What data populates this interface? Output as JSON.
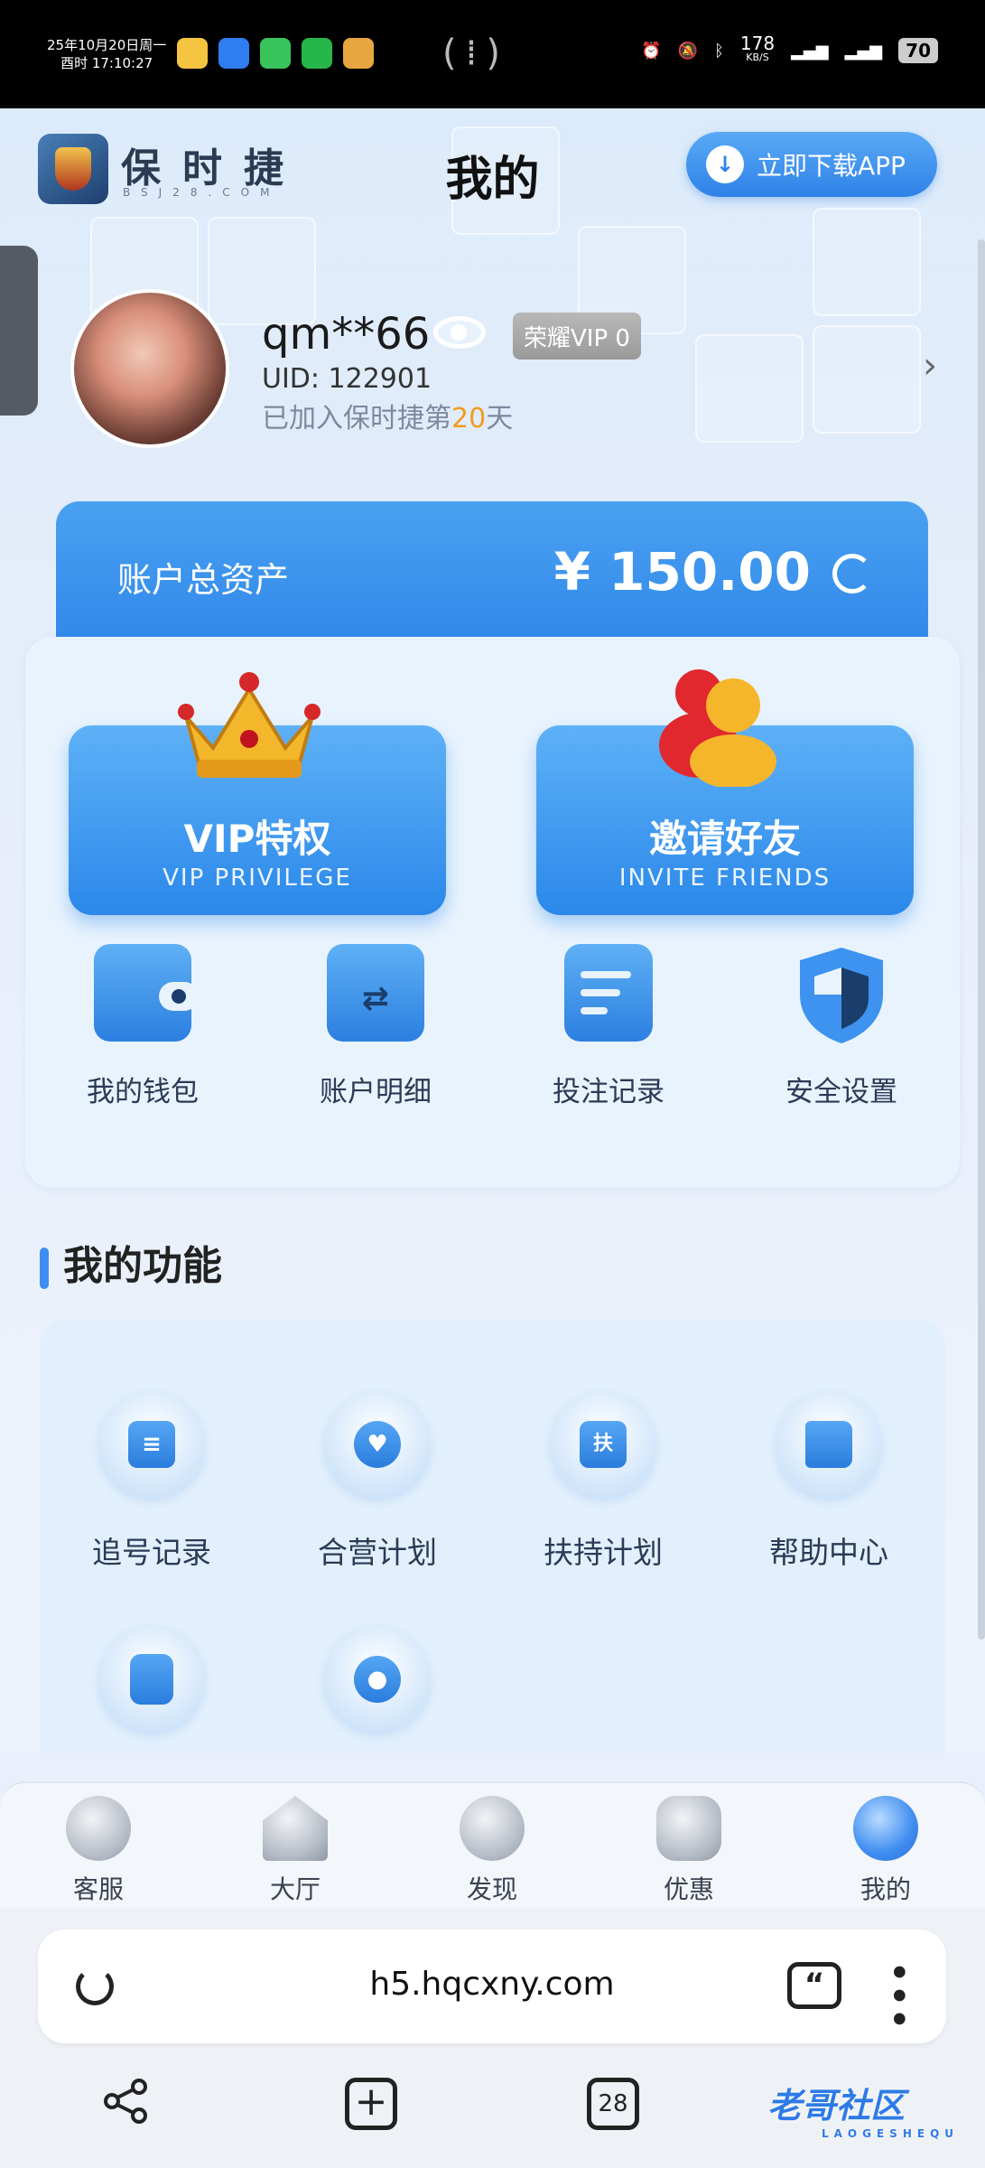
{
  "status_bar": {
    "date_line1": "25年10月20日周一",
    "date_line2": "酉时 17:10:27",
    "speed": "178",
    "speed_unit": "KB/S",
    "battery": "70"
  },
  "header": {
    "brand": "保时捷",
    "brand_sub": "BSJ28.COM",
    "title": "我的",
    "download_label": "立即下载APP"
  },
  "profile": {
    "username": "qm**66",
    "vip_badge": "荣耀VIP 0",
    "uid": "UID: 122901",
    "joined_prefix": "已加入保时捷第",
    "joined_days": "20",
    "joined_suffix": "天"
  },
  "asset": {
    "label": "账户总资产",
    "amount": "¥ 150.00"
  },
  "cards": [
    {
      "title": "VIP特权",
      "subtitle": "VIP PRIVILEGE",
      "icon": "crown-icon"
    },
    {
      "title": "邀请好友",
      "subtitle": "INVITE FRIENDS",
      "icon": "people-icon"
    }
  ],
  "quick_actions": [
    {
      "label": "我的钱包",
      "icon": "wallet-icon"
    },
    {
      "label": "账户明细",
      "icon": "folder-transfer-icon"
    },
    {
      "label": "投注记录",
      "icon": "document-icon"
    },
    {
      "label": "安全设置",
      "icon": "shield-icon"
    }
  ],
  "functions": {
    "title": "我的功能",
    "items": [
      {
        "label": "追号记录",
        "icon": "note-icon"
      },
      {
        "label": "合营计划",
        "icon": "handshake-icon"
      },
      {
        "label": "扶持计划",
        "icon": "support-icon",
        "glyph": "扶"
      },
      {
        "label": "帮助中心",
        "icon": "book-icon"
      },
      {
        "label": "",
        "icon": "tablet-icon"
      },
      {
        "label": "",
        "icon": "gear-icon"
      }
    ]
  },
  "tabbar": [
    {
      "label": "客服",
      "icon": "customer-service-icon"
    },
    {
      "label": "大厅",
      "icon": "home-icon"
    },
    {
      "label": "发现",
      "icon": "discover-icon"
    },
    {
      "label": "优惠",
      "icon": "promo-icon"
    },
    {
      "label": "我的",
      "icon": "profile-icon",
      "active": true
    }
  ],
  "browser": {
    "url": "h5.hqcxny.com",
    "tabs_count": "28"
  },
  "watermark": {
    "text": "老哥社区",
    "sub": "LAOGESHEQU"
  },
  "colors": {
    "accent": "#2f86e9",
    "highlight": "#f39a1f"
  }
}
